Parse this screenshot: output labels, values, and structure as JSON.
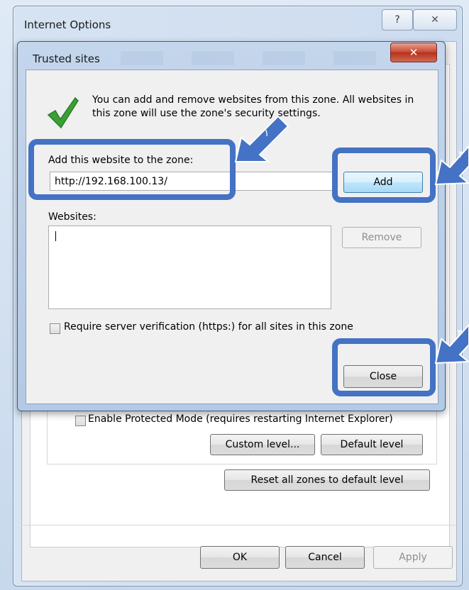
{
  "outer_window": {
    "title": "Internet Options",
    "help_icon": "question-mark-icon",
    "close_icon": "close-icon",
    "protected_mode_label": "Enable Protected Mode (requires restarting Internet Explorer)",
    "custom_level_label": "Custom level...",
    "default_level_label": "Default level",
    "reset_all_label": "Reset all zones to default level",
    "ok_label": "OK",
    "cancel_label": "Cancel",
    "apply_label": "Apply"
  },
  "dialog": {
    "title": "Trusted sites",
    "close_icon": "close-icon",
    "info_icon": "green-checkmark-icon",
    "info_text": "You can add and remove websites from this zone. All websites in this zone will use the zone's security settings.",
    "add_label": "Add this website to the zone:",
    "url_value": "http://192.168.100.13/",
    "add_button": "Add",
    "websites_label": "Websites:",
    "remove_button": "Remove",
    "require_https_label": "Require server verification (https:) for all sites in this zone",
    "close_button": "Close"
  },
  "colors": {
    "highlight": "#4472c4",
    "dialog_frame": "#b3c9e4",
    "close_button_red": "#c7442d",
    "check_green": "#3aa035"
  }
}
